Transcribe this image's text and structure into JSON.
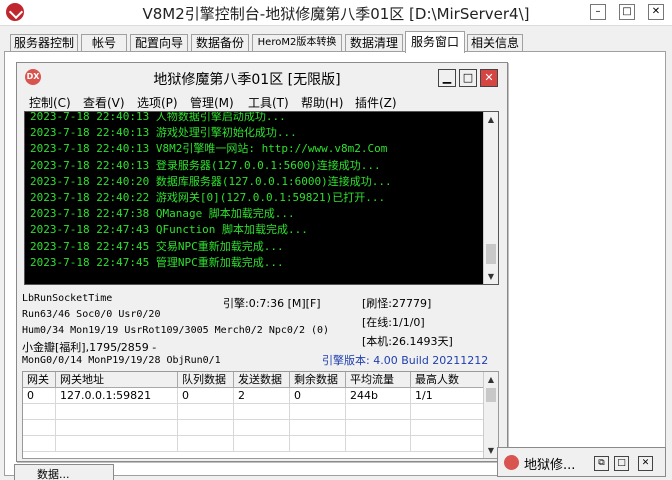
{
  "window": {
    "title": "V8M2引擎控制台-地狱修魔第八季01区 [D:\\MirServer4\\]",
    "minimize": "–",
    "maximize": "□",
    "close": "✕"
  },
  "tabs": [
    {
      "label": "服务器控制"
    },
    {
      "label": "帐号"
    },
    {
      "label": "配置向导"
    },
    {
      "label": "数据备份"
    },
    {
      "label": "HeroM2版本转换"
    },
    {
      "label": "数据清理"
    },
    {
      "label": "服务窗口"
    },
    {
      "label": "相关信息"
    }
  ],
  "active_tab": "服务窗口",
  "inner_window": {
    "logo": "DX",
    "title": "地狱修魔第八季01区 [无限版]",
    "minimize": "▁",
    "maximize": "□",
    "close": "✕",
    "menu": [
      {
        "label": "控制(C)"
      },
      {
        "label": "查看(V)"
      },
      {
        "label": "选项(P)"
      },
      {
        "label": "管理(M)"
      },
      {
        "label": "工具(T)"
      },
      {
        "label": "帮助(H)"
      },
      {
        "label": "插件(Z)"
      }
    ]
  },
  "log": [
    "2023-7-18 22:40:13 人物数据引擎启动成功...",
    "2023-7-18 22:40:13 游戏处理引擎初始化成功...",
    "2023-7-18 22:40:13 V8M2引擎唯一网站: http://www.v8m2.Com",
    "2023-7-18 22:40:13 登录服务器(127.0.0.1:5600)连接成功...",
    "2023-7-18 22:40:20 数据库服务器(127.0.0.1:6000)连接成功...",
    "2023-7-18 22:40:22 游戏网关[0](127.0.0.1:59821)已打开...",
    "2023-7-18 22:47:38 QManage 脚本加载完成...",
    "2023-7-18 22:47:43 QFunction 脚本加载完成...",
    "2023-7-18 22:47:45 交易NPC重新加载完成...",
    "2023-7-18 22:47:45 管理NPC重新加载完成..."
  ],
  "status": {
    "lbrun": "LbRunSocketTime",
    "run": "Run63/46 Soc0/0 Usr0/20",
    "hum": "Hum0/34 Mon19/19 UsrRot109/3005 Merch0/2 Npc0/2 (0)",
    "gold": "小金瓣[福利],1795/2859 -",
    "mon": "MonG0/0/14 MonP19/19/28 ObjRun0/1",
    "engine": "引擎:0:7:36 [M][F]",
    "refresh": "[刷怪:27779]",
    "online": "[在线:1/1/0]",
    "local": "[本机:26.1493天]",
    "version": "引擎版本: 4.00 Build 20211212"
  },
  "grid": {
    "columns": [
      "网关",
      "网关地址",
      "队列数据",
      "发送数据",
      "剩余数据",
      "平均流量",
      "最高人数"
    ],
    "rows": [
      [
        "0",
        "127.0.0.1:59821",
        "0",
        "2",
        "0",
        "244b",
        "1/1"
      ]
    ]
  },
  "minimized": {
    "left_label": "数据...",
    "right_label": "地狱修...",
    "restore": "⧉",
    "maximize": "□",
    "close": "✕"
  },
  "colors": {
    "log_text": "#2ee02e",
    "console_bg": "#000000",
    "close_button": "#d64541",
    "version_text": "#1f3fae"
  }
}
